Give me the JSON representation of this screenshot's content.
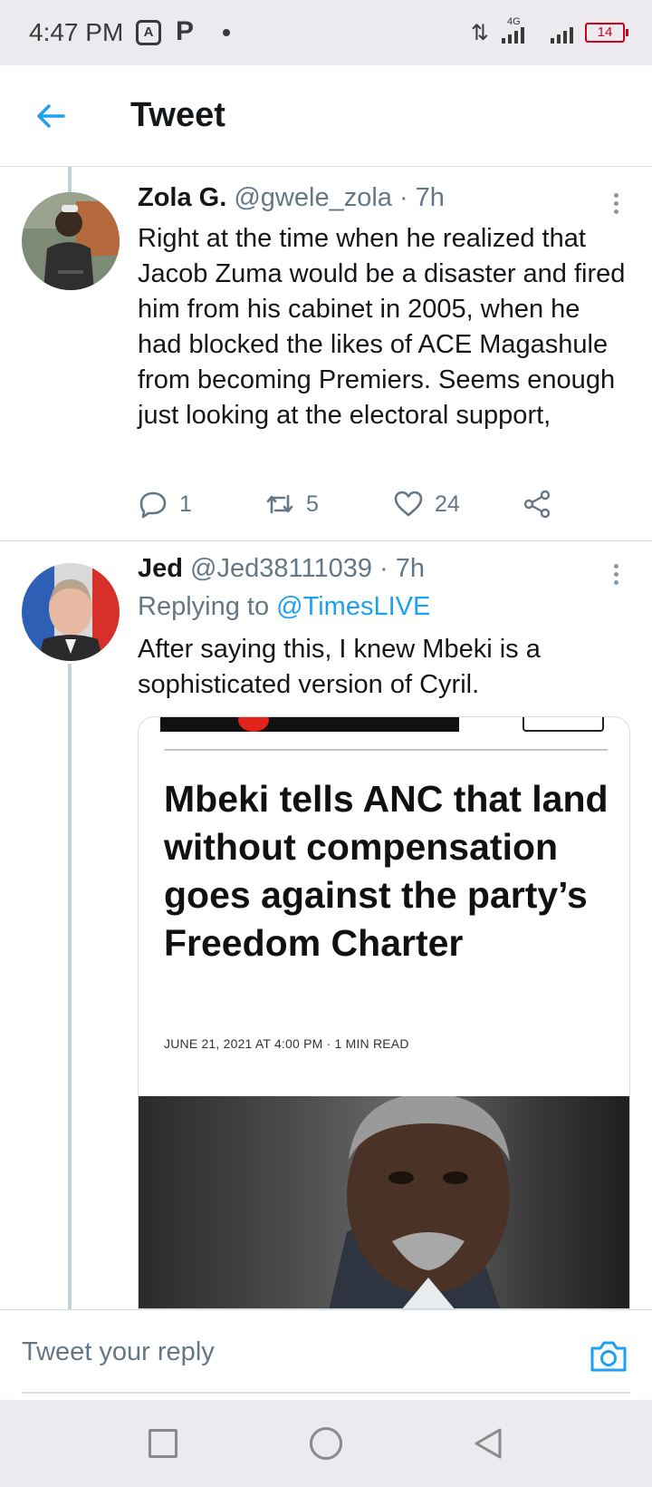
{
  "status_bar": {
    "time": "4:47 PM",
    "network_label": "4G",
    "battery": "14"
  },
  "header": {
    "title": "Tweet",
    "back_icon": "arrow-left-icon",
    "accent_color": "#1da1f2"
  },
  "tweets": [
    {
      "name": "Zola G.",
      "handle": "@gwele_zola",
      "time": "· 7h",
      "text": "Right at the time when he realized that Jacob Zuma would be a disaster and fired him from his cabinet in 2005, when he had blocked the likes of ACE Magashule from becoming Premiers. Seems enough just looking at the electoral support,",
      "replies": "1",
      "retweets": "5",
      "likes": "24"
    },
    {
      "name": "Jed",
      "handle": "@Jed38111039",
      "time": "· 7h",
      "replying_prefix": "Replying to",
      "replying_handle": "@TimesLIVE",
      "text": "After saying this, I knew Mbeki is a sophisticated version of Cyril.",
      "card": {
        "headline": "Mbeki tells ANC that land without compensation goes against the party’s Freedom Charter",
        "date": "JUNE 21, 2021 AT 4:00 PM · 1 MIN READ"
      }
    }
  ],
  "reply_bar": {
    "placeholder": "Tweet your reply",
    "camera_icon": "camera-icon"
  },
  "nav_bar": {
    "icons": [
      "recent-apps-icon",
      "home-icon",
      "back-icon"
    ]
  }
}
